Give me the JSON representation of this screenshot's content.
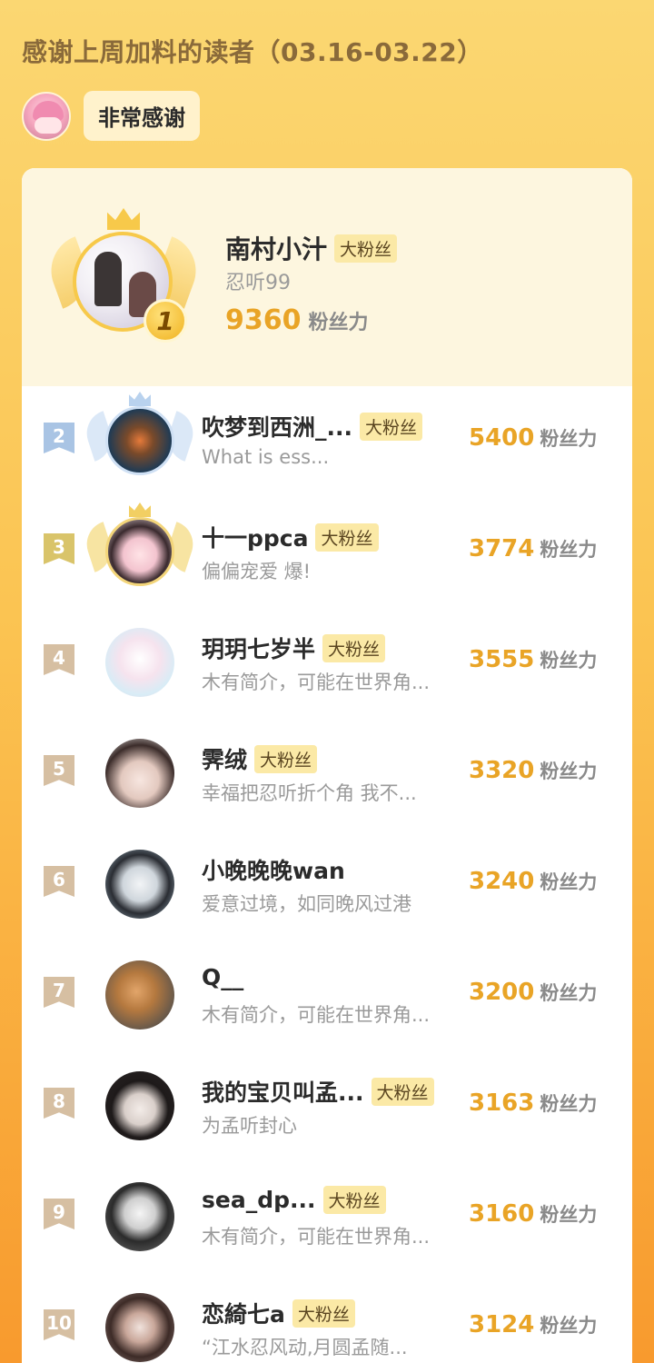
{
  "header": {
    "title": "感谢上周加料的读者（03.16-03.22）",
    "thanks": "非常感谢"
  },
  "top1": {
    "rank": "1",
    "name": "南村小汁",
    "tag": "大粉丝",
    "desc": "忍听99",
    "score": "9360",
    "score_unit": "粉丝力"
  },
  "rows": [
    {
      "rank": "2",
      "name": "吹梦到西洲_...",
      "tag": "大粉丝",
      "desc": "What is ess...",
      "score": "5400",
      "unit": "粉丝力"
    },
    {
      "rank": "3",
      "name": "十一ppca",
      "tag": "大粉丝",
      "desc": "偏偏宠爱 爆!",
      "score": "3774",
      "unit": "粉丝力"
    },
    {
      "rank": "4",
      "name": "玥玥七岁半",
      "tag": "大粉丝",
      "desc": "木有简介，可能在世界角...",
      "score": "3555",
      "unit": "粉丝力"
    },
    {
      "rank": "5",
      "name": "霁绒",
      "tag": "大粉丝",
      "desc": "幸福把忍听折个角 我不...",
      "score": "3320",
      "unit": "粉丝力"
    },
    {
      "rank": "6",
      "name": "小晚晚晚wan",
      "tag": "",
      "desc": "爱意过境，如同晚风过港",
      "score": "3240",
      "unit": "粉丝力"
    },
    {
      "rank": "7",
      "name": "Q__",
      "tag": "",
      "desc": "木有简介，可能在世界角...",
      "score": "3200",
      "unit": "粉丝力"
    },
    {
      "rank": "8",
      "name": "我的宝贝叫孟...",
      "tag": "大粉丝",
      "desc": "为孟听封心",
      "score": "3163",
      "unit": "粉丝力"
    },
    {
      "rank": "9",
      "name": "sea_dp...",
      "tag": "大粉丝",
      "desc": "木有简介，可能在世界角...",
      "score": "3160",
      "unit": "粉丝力"
    },
    {
      "rank": "10",
      "name": "恋綺七a",
      "tag": "大粉丝",
      "desc": "“江水忍风动,月圆孟随...",
      "score": "3124",
      "unit": "粉丝力"
    }
  ],
  "colors": {
    "accent_score": "#e9a426",
    "tag_bg": "#fbe9a6"
  }
}
